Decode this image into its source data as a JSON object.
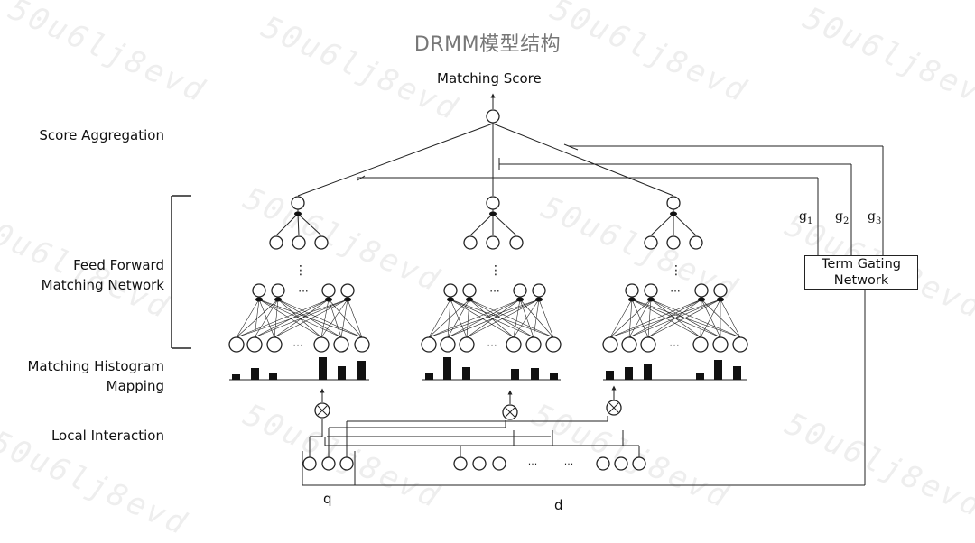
{
  "title": "DRMM模型结构",
  "top_label": "Matching Score",
  "left_labels": {
    "score_aggregation": "Score Aggregation",
    "feed_forward": "Feed Forward\nMatching Network",
    "histogram": "Matching Histogram\nMapping",
    "local_interaction": "Local Interaction"
  },
  "gating": {
    "box_label": "Term Gating\nNetwork",
    "g1": "g",
    "g1_sub": "1",
    "g2": "g",
    "g2_sub": "2",
    "g3": "g",
    "g3_sub": "3"
  },
  "inputs": {
    "query": "q",
    "document": "d"
  },
  "ellipsis": "···",
  "vdots": "⋮",
  "watermark": "50u6lj8evd",
  "colors": {
    "line": "#222222",
    "title": "#777777",
    "watermark": "#eeeeee"
  }
}
